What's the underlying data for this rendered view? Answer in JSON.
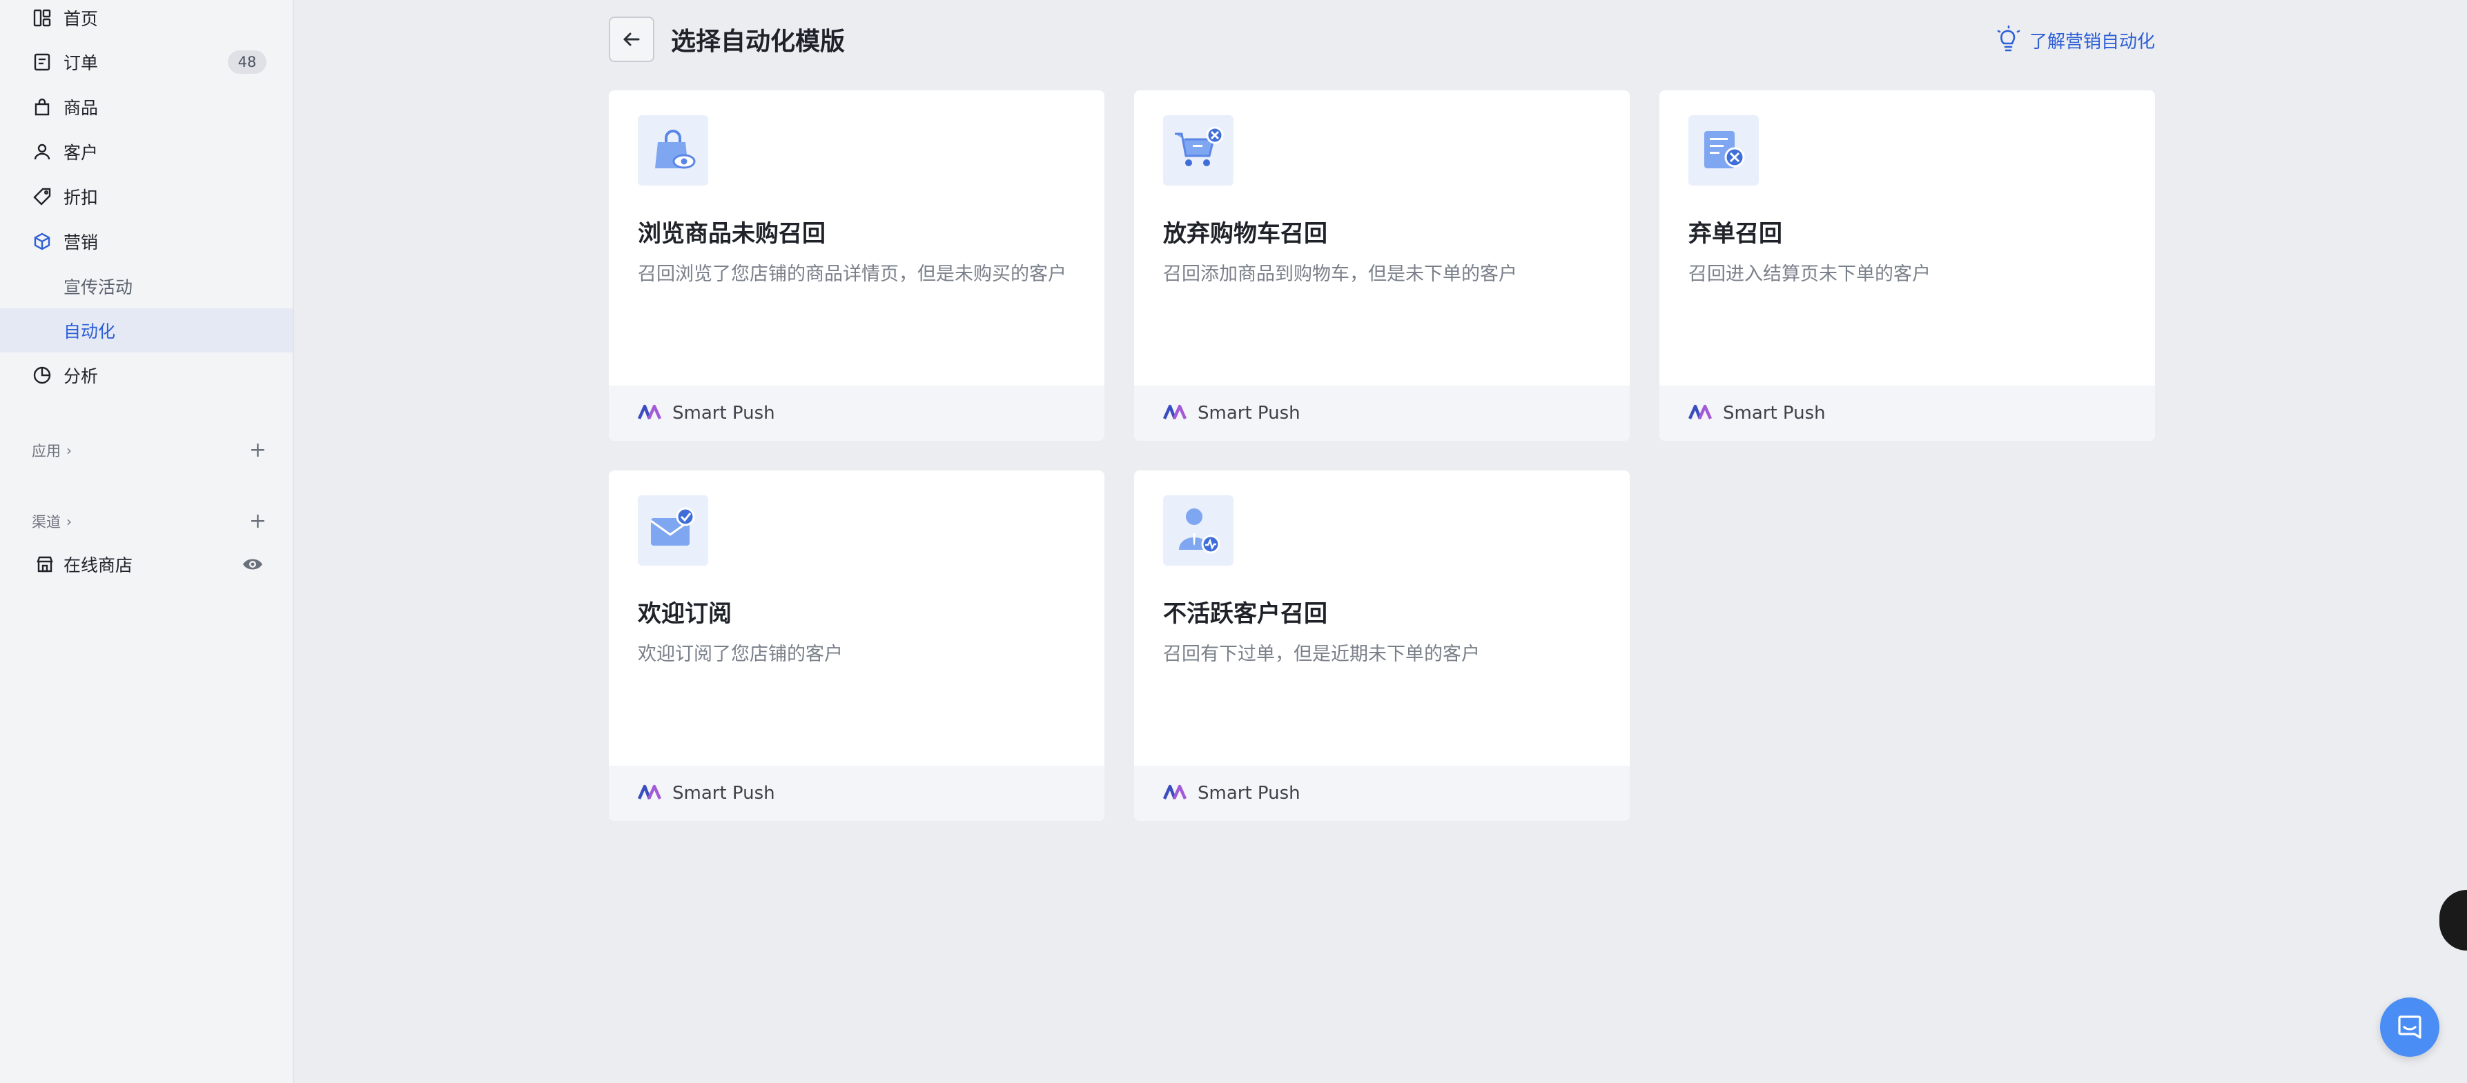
{
  "sidebar": {
    "items": [
      {
        "label": "首页",
        "icon": "home-icon"
      },
      {
        "label": "订单",
        "icon": "order-icon",
        "badge": "48"
      },
      {
        "label": "商品",
        "icon": "bag-icon"
      },
      {
        "label": "客户",
        "icon": "user-icon"
      },
      {
        "label": "折扣",
        "icon": "tag-icon"
      },
      {
        "label": "营销",
        "icon": "cube-icon"
      },
      {
        "label": "宣传活动"
      },
      {
        "label": "自动化"
      },
      {
        "label": "分析",
        "icon": "pie-icon"
      }
    ],
    "apps_section": {
      "label": "应用"
    },
    "channels_section": {
      "label": "渠道"
    },
    "online_store": {
      "label": "在线商店",
      "icon": "store-icon"
    }
  },
  "header": {
    "title": "选择自动化模版",
    "learn_link": "了解营销自动化"
  },
  "templates": [
    {
      "title": "浏览商品未购召回",
      "desc": "召回浏览了您店铺的商品详情页，但是未购买的客户",
      "provider": "Smart Push",
      "icon": "bag-eye-icon"
    },
    {
      "title": "放弃购物车召回",
      "desc": "召回添加商品到购物车，但是未下单的客户",
      "provider": "Smart Push",
      "icon": "cart-x-icon"
    },
    {
      "title": "弃单召回",
      "desc": "召回进入结算页未下单的客户",
      "provider": "Smart Push",
      "icon": "document-x-icon"
    },
    {
      "title": "欢迎订阅",
      "desc": "欢迎订阅了您店铺的客户",
      "provider": "Smart Push",
      "icon": "mail-check-icon"
    },
    {
      "title": "不活跃客户召回",
      "desc": "召回有下过单，但是近期未下单的客户",
      "provider": "Smart Push",
      "icon": "person-pulse-icon"
    }
  ],
  "colors": {
    "accent": "#2d5fd6",
    "background": "#ebedf1",
    "sidebar_bg": "#f3f4f6",
    "card_footer": "#f4f5f8",
    "chat_button": "#4a8df5"
  }
}
